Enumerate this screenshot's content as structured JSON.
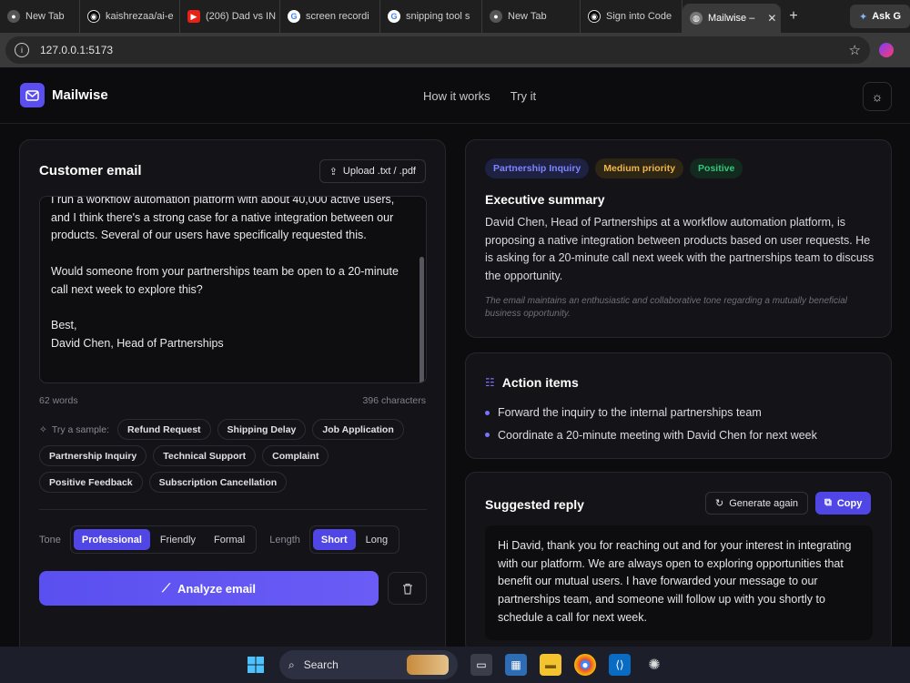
{
  "browser": {
    "tabs": [
      {
        "title": "New Tab",
        "icon": "chrome-icon"
      },
      {
        "title": "kaishrezaa/ai-e",
        "icon": "github-icon"
      },
      {
        "title": "(206) Dad vs IN",
        "icon": "youtube-icon"
      },
      {
        "title": "screen recordi",
        "icon": "google-icon"
      },
      {
        "title": "snipping tool s",
        "icon": "google-icon"
      },
      {
        "title": "New Tab",
        "icon": "chrome-icon"
      },
      {
        "title": "Sign into Code",
        "icon": "github-icon"
      },
      {
        "title": "Mailwise –",
        "icon": "globe-icon",
        "active": true
      }
    ],
    "ask": "Ask G",
    "url": "127.0.0.1:5173"
  },
  "header": {
    "brand": "Mailwise",
    "links": [
      "How it works",
      "Try it"
    ]
  },
  "input": {
    "title": "Customer email",
    "upload_label": "Upload .txt / .pdf",
    "paragraphs": [
      "I run a workflow automation platform with about 40,000 active users, and I think there's a strong case for a native integration between our products. Several of our users have specifically requested this.",
      "Would someone from your partnerships team be open to a 20-minute call next week to explore this?",
      "Best,\nDavid Chen, Head of Partnerships"
    ],
    "word_count": "62 words",
    "char_count": "396 characters",
    "sample_label": "Try a sample:",
    "samples": [
      "Refund Request",
      "Shipping Delay",
      "Job Application",
      "Partnership Inquiry",
      "Technical Support",
      "Complaint",
      "Positive Feedback",
      "Subscription Cancellation"
    ],
    "tone_label": "Tone",
    "tones": [
      "Professional",
      "Friendly",
      "Formal"
    ],
    "tone_selected": "Professional",
    "length_label": "Length",
    "lengths": [
      "Short",
      "Long"
    ],
    "length_selected": "Short",
    "analyze_label": "Analyze email"
  },
  "summary": {
    "tags": [
      {
        "label": "Partnership Inquiry",
        "color": "#7d86ff",
        "bg": "#1e2142"
      },
      {
        "label": "Medium priority",
        "color": "#f0b64a",
        "bg": "#2e2614"
      },
      {
        "label": "Positive",
        "color": "#34c77b",
        "bg": "#132a1f"
      }
    ],
    "title": "Executive summary",
    "body": "David Chen, Head of Partnerships at a workflow automation platform, is proposing a native integration between products based on user requests. He is asking for a 20-minute call next week with the partnerships team to discuss the opportunity.",
    "tone_note": "The email maintains an enthusiastic and collaborative tone regarding a mutually beneficial business opportunity."
  },
  "actions": {
    "title": "Action items",
    "items": [
      "Forward the inquiry to the internal partnerships team",
      "Coordinate a 20-minute meeting with David Chen for next week"
    ]
  },
  "reply": {
    "title": "Suggested reply",
    "regenerate_label": "Generate again",
    "copy_label": "Copy",
    "body": "Hi David, thank you for reaching out and for your interest in integrating with our platform. We are always open to exploring opportunities that benefit our mutual users. I have forwarded your message to our partnerships team, and someone will follow up with you shortly to schedule a call for next week."
  },
  "taskbar": {
    "search_placeholder": "Search"
  },
  "colors": {
    "accent": "#4f46e5",
    "background": "#0c0c0f",
    "card": "#141418"
  }
}
